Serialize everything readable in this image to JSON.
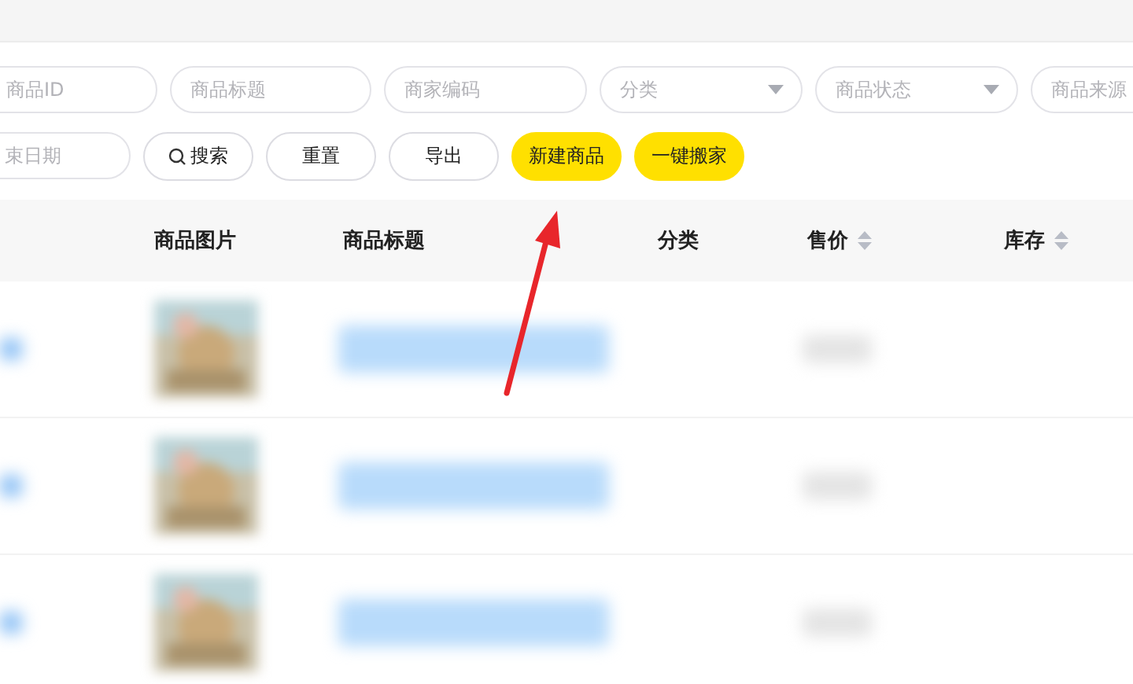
{
  "filters": [
    {
      "placeholder": "商品ID",
      "kind": "text"
    },
    {
      "placeholder": "商品标题",
      "kind": "text"
    },
    {
      "placeholder": "商家编码",
      "kind": "text"
    },
    {
      "placeholder": "分类",
      "kind": "select"
    },
    {
      "placeholder": "商品状态",
      "kind": "select"
    },
    {
      "placeholder": "商品来源",
      "kind": "text"
    }
  ],
  "date_field": {
    "placeholder": "束日期"
  },
  "buttons": [
    {
      "label": "搜索",
      "kind": "search"
    },
    {
      "label": "重置",
      "kind": "outline"
    },
    {
      "label": "导出",
      "kind": "outline"
    },
    {
      "label": "新建商品",
      "kind": "primary"
    },
    {
      "label": "一键搬家",
      "kind": "primary"
    }
  ],
  "table": {
    "columns": [
      {
        "label": "商品图片",
        "sortable": false
      },
      {
        "label": "商品标题",
        "sortable": false
      },
      {
        "label": "分类",
        "sortable": false
      },
      {
        "label": "售价",
        "sortable": true
      },
      {
        "label": "库存",
        "sortable": true
      }
    ],
    "rows": [
      {
        "kind": "blurred"
      },
      {
        "kind": "blurred"
      },
      {
        "kind": "blurred"
      }
    ]
  }
}
